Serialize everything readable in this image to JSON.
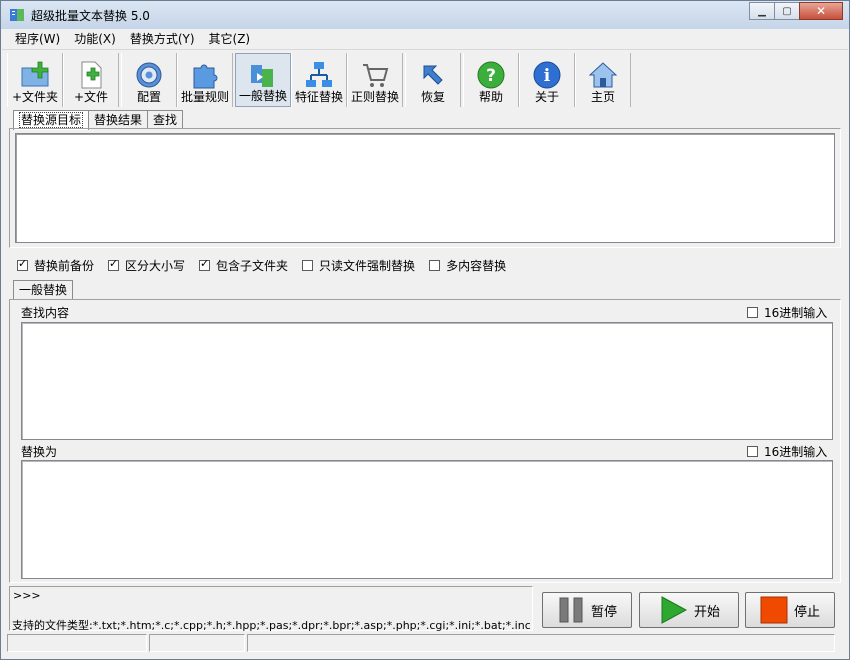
{
  "window": {
    "title": "超级批量文本替换 5.0"
  },
  "menu": [
    "程序(W)",
    "功能(X)",
    "替换方式(Y)",
    "其它(Z)"
  ],
  "toolbar": [
    {
      "label": "+文件夹",
      "icon": "add-folder-icon"
    },
    {
      "label": "+文件",
      "icon": "add-file-icon"
    },
    {
      "label": "配置",
      "icon": "config-gear-icon"
    },
    {
      "label": "批量规则",
      "icon": "puzzle-icon"
    },
    {
      "label": "一般替换",
      "icon": "normal-replace-icon"
    },
    {
      "label": "特征替换",
      "icon": "feature-replace-icon"
    },
    {
      "label": "正则替换",
      "icon": "cart-icon"
    },
    {
      "label": "恢复",
      "icon": "restore-arrow-icon"
    },
    {
      "label": "帮助",
      "icon": "help-icon"
    },
    {
      "label": "关于",
      "icon": "info-icon"
    },
    {
      "label": "主页",
      "icon": "home-icon"
    }
  ],
  "top_tabs": [
    "替换源目标",
    "替换结果",
    "查找"
  ],
  "options": [
    {
      "label": "替换前备份",
      "checked": true
    },
    {
      "label": "区分大小写",
      "checked": true
    },
    {
      "label": "包含子文件夹",
      "checked": true
    },
    {
      "label": "只读文件强制替换",
      "checked": false
    },
    {
      "label": "多内容替换",
      "checked": false
    }
  ],
  "replace_tab": "一般替换",
  "find": {
    "label": "查找内容",
    "hex_label": "16进制输入",
    "value": ""
  },
  "replace": {
    "label": "替换为",
    "hex_label": "16进制输入",
    "value": ""
  },
  "log": {
    "prompt": ">>>",
    "filetypes": "支持的文件类型:*.txt;*.htm;*.c;*.cpp;*.h;*.hpp;*.pas;*.dpr;*.bpr;*.asp;*.php;*.cgi;*.ini;*.bat;*.inc;*.java;*.py;*.dfm"
  },
  "buttons": {
    "pause": "暂停",
    "start": "开始",
    "stop": "停止"
  },
  "colors": {
    "start_green": "#2fa82f",
    "stop_orange": "#f04a00",
    "pause_gray": "#707070"
  }
}
